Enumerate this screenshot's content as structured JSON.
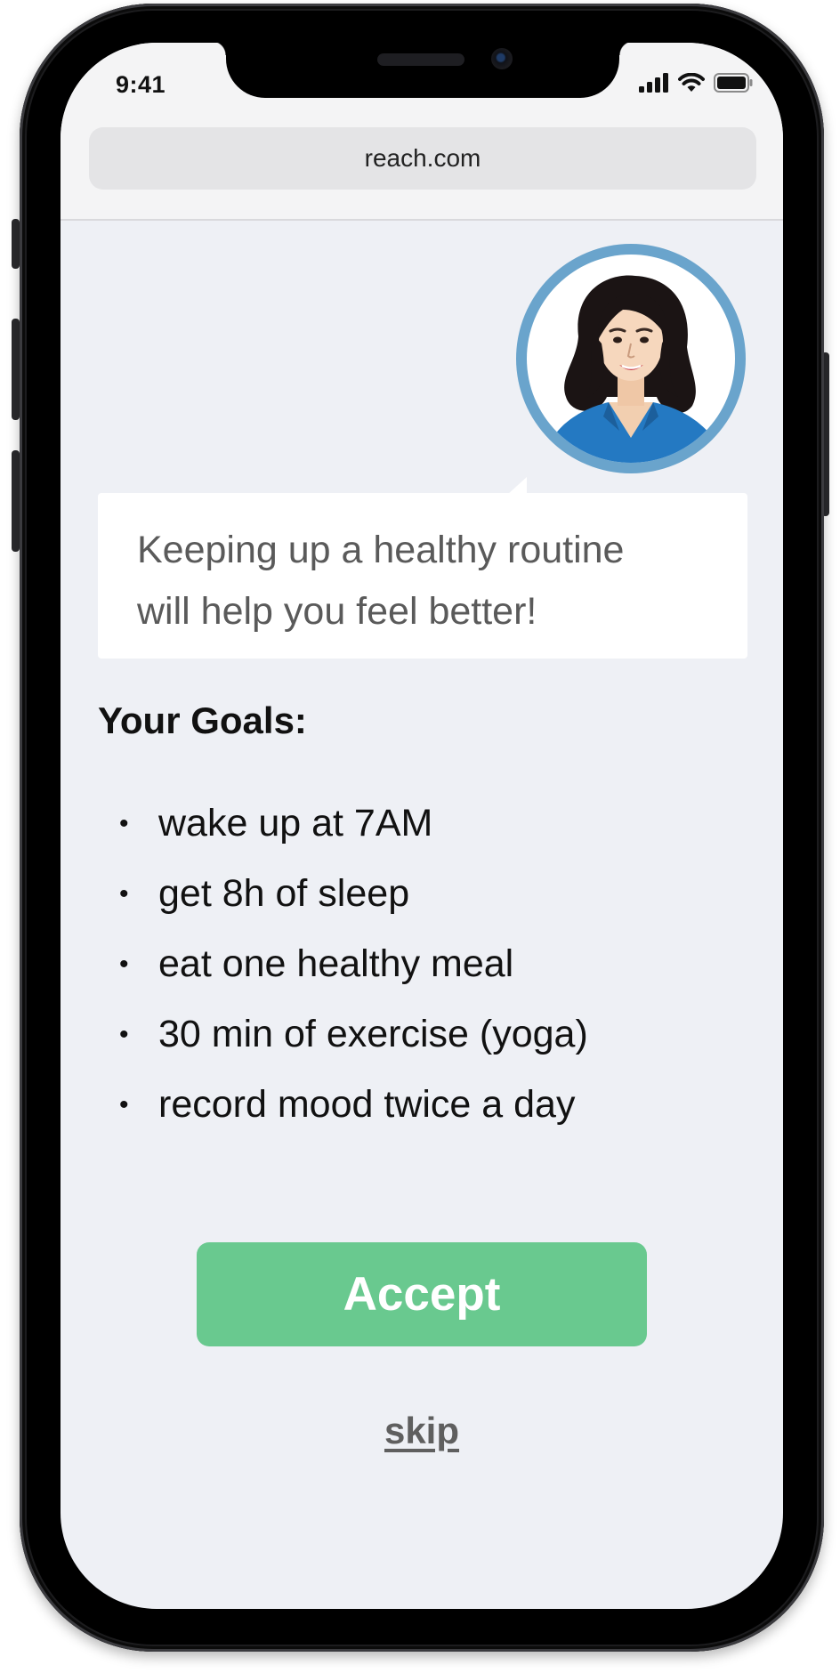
{
  "status_bar": {
    "time": "9:41",
    "icons": [
      "cellular-signal-icon",
      "wifi-icon",
      "battery-icon"
    ]
  },
  "browser": {
    "url": "reach.com"
  },
  "coach": {
    "avatar_icon": "coach-avatar-icon",
    "message_line1": "Keeping up a healthy routine",
    "message_line2": "will help you feel better!"
  },
  "goals": {
    "title": "Your Goals:",
    "bullet": "•",
    "items": [
      "wake up at 7AM",
      "get 8h of sleep",
      "eat one healthy meal",
      "30 min of exercise (yoga)",
      "record mood twice a day"
    ]
  },
  "actions": {
    "accept_label": "Accept",
    "skip_label": "skip"
  },
  "colors": {
    "accent_green": "#69c98f",
    "avatar_ring": "#6aa4cc",
    "screen_background": "#eef0f5",
    "link_gray": "#5f5f5f"
  }
}
